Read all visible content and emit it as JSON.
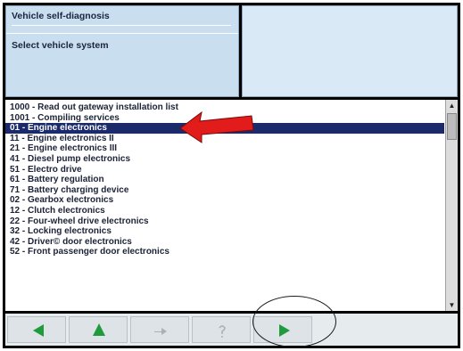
{
  "panel": {
    "title": "Vehicle self-diagnosis",
    "subtitle": "Select vehicle system"
  },
  "list": {
    "items": [
      "1000 - Read out gateway installation list",
      "1001 - Compiling services",
      "01 - Engine electronics",
      "11 - Engine electronics II",
      "21 - Engine electronics III",
      "41 - Diesel pump electronics",
      "51 - Electro drive",
      "61 - Battery regulation",
      "71 - Battery charging device",
      "02 - Gearbox electronics",
      "12 - Clutch electronics",
      "22 - Four-wheel drive electronics",
      "32 - Locking electronics",
      "42 - Driver© door electronics",
      "52 - Front passenger door electronics"
    ],
    "selected_index": 2
  },
  "scrollbar": {
    "up_icon": "triangle-up-icon",
    "down_icon": "triangle-down-icon"
  },
  "toolbar": {
    "buttons": [
      {
        "icon": "arrow-left-icon",
        "enabled": true
      },
      {
        "icon": "arrow-up-icon",
        "enabled": true
      },
      {
        "icon": "hand-icon",
        "enabled": false
      },
      {
        "icon": "question-icon",
        "enabled": false
      },
      {
        "icon": "arrow-right-icon",
        "enabled": true
      }
    ],
    "status_text": ""
  },
  "colors": {
    "selection": "#1b2a6b",
    "arrow_green": "#1f9a3c",
    "callout_red": "#e21b1b",
    "panel_blue": "#c9deef"
  }
}
